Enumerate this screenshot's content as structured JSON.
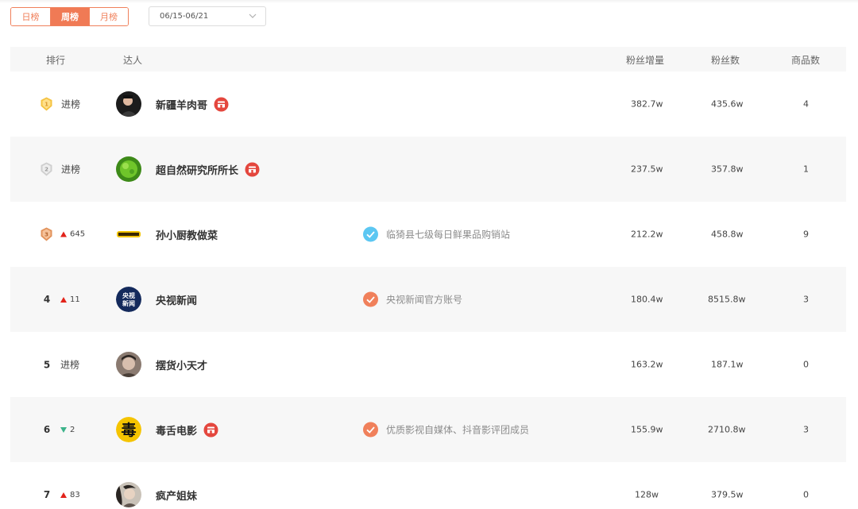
{
  "tabs": [
    {
      "label": "日榜",
      "active": false
    },
    {
      "label": "周榜",
      "active": true
    },
    {
      "label": "月榜",
      "active": false
    }
  ],
  "date_range": "06/15-06/21",
  "columns": {
    "rank": "排行",
    "talent": "达人",
    "fans_growth": "粉丝增量",
    "fans": "粉丝数",
    "products": "商品数"
  },
  "colors": {
    "accent": "#f07a55",
    "up": "#e2231a",
    "down": "#3cb38a",
    "verify_blue": "#5cc7f2",
    "verify_orange": "#f0805b"
  },
  "rows": [
    {
      "rank": "1",
      "medal": "gold",
      "change": "进榜",
      "name": "新疆羊肉哥",
      "shop_badge": true,
      "verify": "",
      "fans_growth": "382.7w",
      "fans": "435.6w",
      "products": "4"
    },
    {
      "rank": "2",
      "medal": "silver",
      "change": "进榜",
      "name": "超自然研究所所长",
      "shop_badge": true,
      "verify": "",
      "fans_growth": "237.5w",
      "fans": "357.8w",
      "products": "1"
    },
    {
      "rank": "3",
      "medal": "bronze",
      "change": "645",
      "change_dir": "up",
      "name": "孙小厨教做菜",
      "shop_badge": false,
      "verify": "临猗县七级每日鲜果品购销站",
      "verify_type": "blue",
      "fans_growth": "212.2w",
      "fans": "458.8w",
      "products": "9"
    },
    {
      "rank": "4",
      "change": "11",
      "change_dir": "up",
      "name": "央视新闻",
      "shop_badge": false,
      "verify": "央视新闻官方账号",
      "verify_type": "orange",
      "fans_growth": "180.4w",
      "fans": "8515.8w",
      "products": "3",
      "avatar_text": "央视\n新闻"
    },
    {
      "rank": "5",
      "change": "进榜",
      "name": "摆货小天才",
      "shop_badge": false,
      "verify": "",
      "fans_growth": "163.2w",
      "fans": "187.1w",
      "products": "0"
    },
    {
      "rank": "6",
      "change": "2",
      "change_dir": "down",
      "name": "毒舌电影",
      "shop_badge": true,
      "verify": "优质影视自媒体、抖音影评团成员",
      "verify_type": "orange",
      "fans_growth": "155.9w",
      "fans": "2710.8w",
      "products": "3",
      "avatar_text": "毒"
    },
    {
      "rank": "7",
      "change": "83",
      "change_dir": "up",
      "name": "疯产姐妹",
      "shop_badge": false,
      "verify": "",
      "fans_growth": "128w",
      "fans": "379.5w",
      "products": "0"
    }
  ]
}
